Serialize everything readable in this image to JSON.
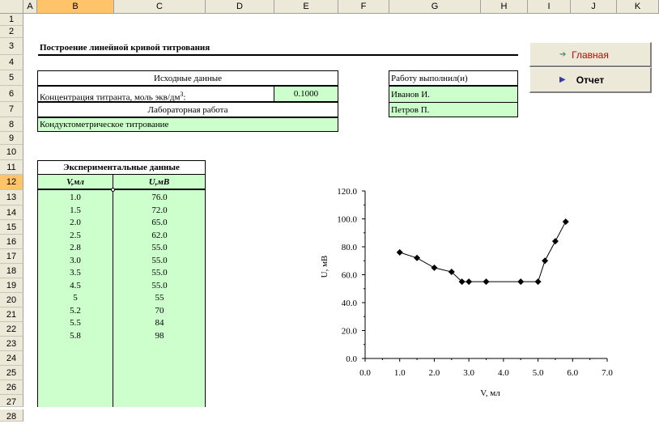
{
  "columns": [
    "A",
    "B",
    "C",
    "D",
    "E",
    "F",
    "G",
    "H",
    "I",
    "J",
    "K"
  ],
  "rows": [
    "1",
    "2",
    "3",
    "4",
    "5",
    "6",
    "7",
    "8",
    "9",
    "10",
    "11",
    "12",
    "13",
    "14",
    "15",
    "16",
    "17",
    "18",
    "19",
    "20",
    "21",
    "22",
    "23",
    "24",
    "25",
    "26",
    "27",
    "28"
  ],
  "selected_column": "B",
  "selected_row": "12",
  "title": "Построение линейной кривой титрования",
  "input_section": {
    "header": "Исходные данные",
    "concentration_label": "Концентрация титранта, моль экв/дм",
    "concentration_sup": "3",
    "concentration_suffix": ":",
    "concentration_value": "0.1000",
    "lab_header": "Лабораторная работа",
    "lab_name": "Кондуктометрическое титрование"
  },
  "author_section": {
    "header": "Работу выполнил(и)",
    "names": [
      "Иванов И.",
      "Петров П."
    ]
  },
  "buttons": {
    "main": "Главная",
    "report": "Отчет"
  },
  "experimental": {
    "header": "Экспериментальные данные",
    "col_v": "V,мл",
    "col_u": "U,мВ",
    "v_values": [
      "1.0",
      "1.5",
      "2.0",
      "2.5",
      "2.8",
      "3.0",
      "3.5",
      "4.5",
      "5",
      "5.2",
      "5.5",
      "5.8"
    ],
    "u_values": [
      "76.0",
      "72.0",
      "65.0",
      "62.0",
      "55.0",
      "55.0",
      "55.0",
      "55.0",
      "55",
      "70",
      "84",
      "98"
    ]
  },
  "chart_data": {
    "type": "line",
    "x": [
      1.0,
      1.5,
      2.0,
      2.5,
      2.8,
      3.0,
      3.5,
      4.5,
      5.0,
      5.2,
      5.5,
      5.8
    ],
    "y": [
      76,
      72,
      65,
      62,
      55,
      55,
      55,
      55,
      55,
      70,
      84,
      98
    ],
    "xlabel": "V, мл",
    "ylabel": "U, мВ",
    "xlim": [
      0,
      7
    ],
    "ylim": [
      0,
      120
    ],
    "x_ticks": [
      "0.0",
      "1.0",
      "2.0",
      "3.0",
      "4.0",
      "5.0",
      "6.0",
      "7.0"
    ],
    "y_ticks": [
      "0.0",
      "20.0",
      "40.0",
      "60.0",
      "80.0",
      "100.0",
      "120.0"
    ],
    "grid": false,
    "marker": "diamond",
    "line_color": "#000000"
  }
}
